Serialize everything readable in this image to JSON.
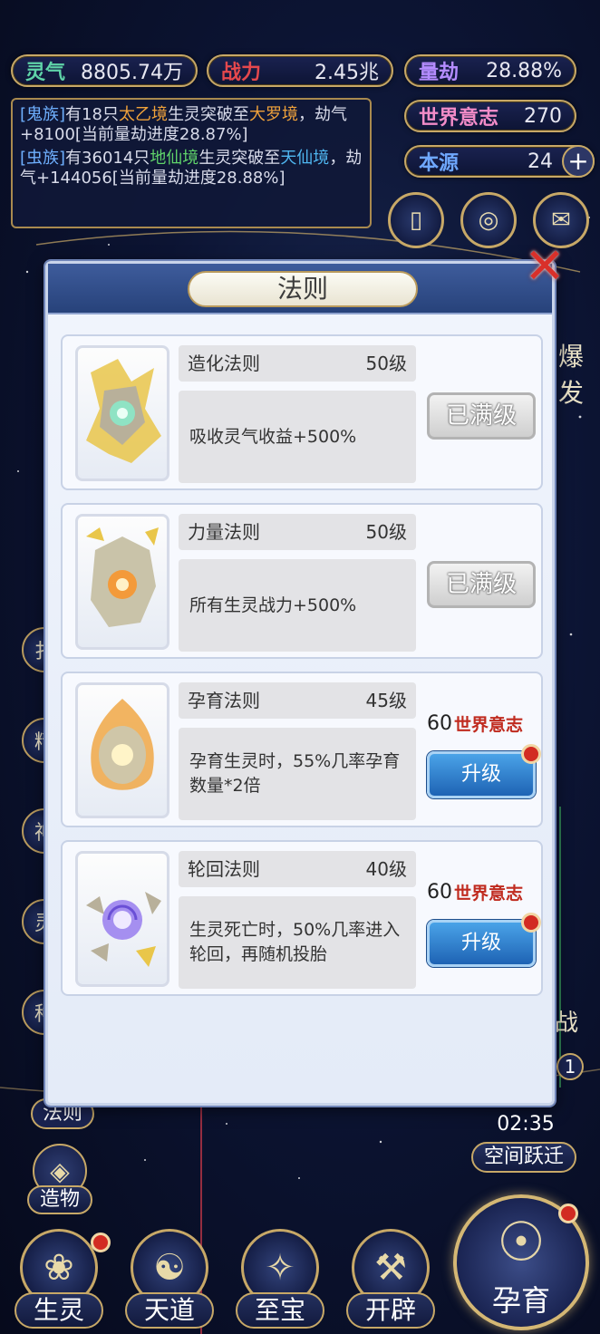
{
  "resources": {
    "lingqi": {
      "label": "灵气",
      "value": "8805.74万",
      "color": "#5fd3a8"
    },
    "zhanli": {
      "label": "战力",
      "value": "2.45兆",
      "color": "#e5484d"
    },
    "liangjie": {
      "label": "量劫",
      "value": "28.88%",
      "color": "#b48cff"
    },
    "shijie_yizhi": {
      "label": "世界意志",
      "value": "270",
      "color": "#f28cc8"
    },
    "benyuan": {
      "label": "本源",
      "value": "24",
      "color": "#6fa8ff"
    }
  },
  "log": {
    "line1": {
      "tag": "[鬼族]",
      "t1": "有18只",
      "realm_a": "太乙境",
      "t2": "生灵突破至",
      "realm_b": "大罗境",
      "t3": "，劫气+8100[当前量劫进度28.87%]"
    },
    "line2": {
      "tag": "[虫族]",
      "t1": "有36014只",
      "realm_a": "地仙境",
      "t2": "生灵突破至",
      "realm_b": "天仙境",
      "t3": "，劫气+144056[当前量劫进度28.88%]"
    }
  },
  "side": {
    "right_partial_a": "爆发",
    "left_chips": [
      "扌",
      "精",
      "神",
      "灵",
      "种"
    ],
    "left_faze": "法则",
    "right_partial_b": "战",
    "right_partial_c": "1"
  },
  "panel": {
    "title": "法则",
    "laws": [
      {
        "name": "造化法则",
        "level": "50级",
        "desc": "吸收灵气收益+500%",
        "button": "已满级",
        "maxed": true
      },
      {
        "name": "力量法则",
        "level": "50级",
        "desc": "所有生灵战力+500%",
        "button": "已满级",
        "maxed": true
      },
      {
        "name": "孕育法则",
        "level": "45级",
        "desc": "孕育生灵时，55%几率孕育数量*2倍",
        "cost_num": "60",
        "cost_label": "世界意志",
        "button": "升级",
        "maxed": false
      },
      {
        "name": "轮回法则",
        "level": "40级",
        "desc": "生灵死亡时，50%几率进入轮回，再随机投胎",
        "cost_num": "60",
        "cost_label": "世界意志",
        "button": "升级",
        "maxed": false
      }
    ]
  },
  "bottom": {
    "zaowu": "造物",
    "timer": "02:35",
    "jump": "空间跃迁",
    "nav": [
      "生灵",
      "天道",
      "至宝",
      "开辟"
    ],
    "main": "孕育"
  }
}
